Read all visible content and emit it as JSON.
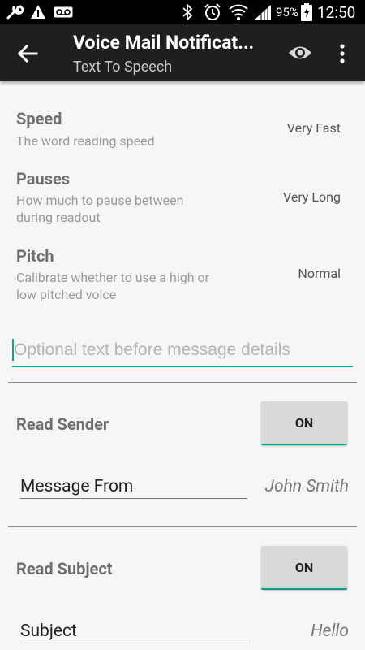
{
  "status_bar": {
    "battery_percent": "95%",
    "time": "12:50",
    "icons": [
      "wrench-icon",
      "warning-icon",
      "voicemail-icon",
      "bluetooth-icon",
      "alarm-icon",
      "wifi-icon",
      "signal-icon",
      "battery-charging-icon"
    ]
  },
  "app_bar": {
    "title": "Voice Mail Notificat...",
    "subtitle": "Text To Speech",
    "icons": [
      "back-arrow-icon",
      "eye-icon",
      "more-vert-icon"
    ]
  },
  "prefs": [
    {
      "title": "Speed",
      "summary": "The word reading speed",
      "value": "Very Fast"
    },
    {
      "title": "Pauses",
      "summary": "How much to pause between during readout",
      "value": "Very Long"
    },
    {
      "title": "Pitch",
      "summary": "Calibrate whether to use a high or low pitched voice",
      "value": "Normal"
    }
  ],
  "prefix_field": {
    "placeholder": "Optional text before message details",
    "value": ""
  },
  "read_sender": {
    "label": "Read Sender",
    "toggle": "ON",
    "field_value": "Message From",
    "example": "John Smith"
  },
  "read_subject": {
    "label": "Read Subject",
    "toggle": "ON",
    "field_value": "Subject",
    "example": "Hello"
  },
  "colors": {
    "accent": "#1f9688",
    "app_bar": "#1f1f1f",
    "status_bar": "#000000",
    "background": "#f6f6f6"
  }
}
